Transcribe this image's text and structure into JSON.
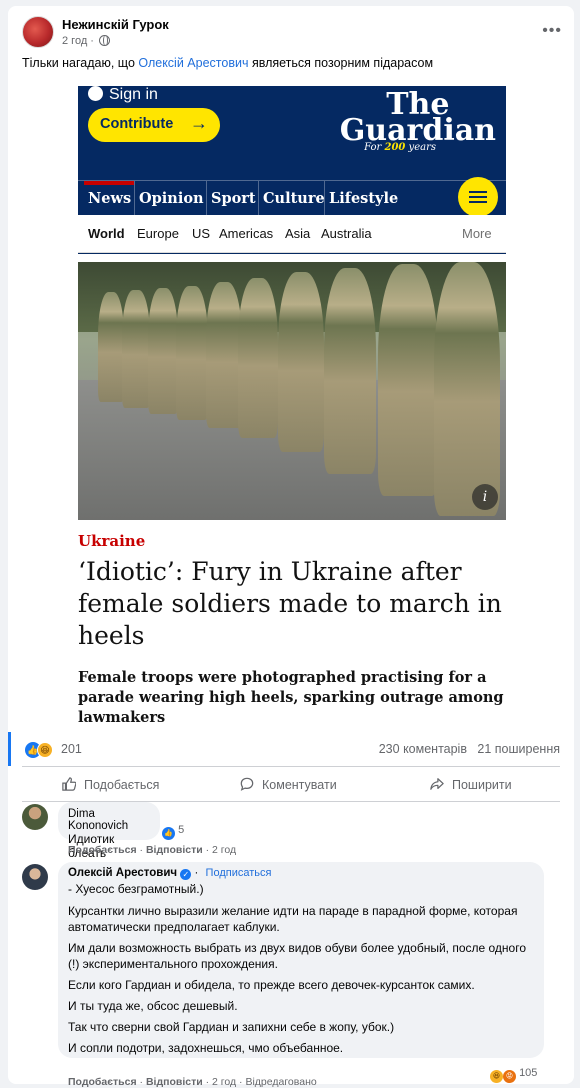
{
  "post": {
    "author": "Нежинскій Гурок",
    "time": "2 год",
    "text_before": "Тільки нагадаю, що ",
    "mention": "Олексій Арестович",
    "text_after": "  являеться позорним підарасом"
  },
  "guardian": {
    "sign_in": "Sign in",
    "contribute": "Contribute",
    "logo_line1": "The",
    "logo_line2": "Guardian",
    "tagline_prefix": "For ",
    "tagline_number": "200",
    "tagline_suffix": " years",
    "pillars": [
      "News",
      "Opinion",
      "Sport",
      "Culture",
      "Lifestyle"
    ],
    "subnav": [
      "World",
      "Europe",
      "US",
      "Americas",
      "Asia",
      "Australia"
    ],
    "subnav_more": "More",
    "kicker": "Ukraine",
    "headline": "‘Idiotic’: Fury in Ukraine after female soldiers made to march in heels",
    "standfirst": "Female troops were photographed practising for a parade wearing high heels, sparking outrage among lawmakers",
    "info_glyph": "i"
  },
  "stats": {
    "reactions": "201",
    "comments": "230 коментарів",
    "shares": "21 поширення"
  },
  "actions": {
    "like": "Подобається",
    "comment": "Коментувати",
    "share": "Поширити"
  },
  "comments": [
    {
      "author": "Dima Kononovich",
      "text": "Идиотик блеать",
      "reaction_count": "5",
      "like": "Подобається",
      "reply": "Відповісти",
      "time": "2 год"
    },
    {
      "author": "Олексій Арестович",
      "follow": "Подписаться",
      "paragraphs": [
        "- Хуесос безграмотный.)",
        "Курсантки лично выразили желание идти на параде в парадной форме, которая автоматически предполагает каблуки.",
        "Им дали возможность выбрать из двух видов обуви более удобный, после одного (!) экспериментального прохождения.",
        "Если кого Гардиан и обидела, то прежде всего девочек-курсанток самих.",
        "И ты туда же, обсос дешевый.",
        "Так что сверни свой Гардиан и запихни себе в жопу, убок.)",
        "И сопли подотри, задохнешься, чмо объебанное."
      ],
      "reaction_count": "105",
      "like": "Подобається",
      "reply": "Відповісти",
      "time": "2 год",
      "edited": "Відредаговано"
    }
  ],
  "icons": {
    "more": "more-horizontal-icon",
    "globe": "globe-icon",
    "like": "thumbs-up-icon",
    "comment": "comment-bubble-icon",
    "share": "share-arrow-icon"
  },
  "colors": {
    "guardian_navy": "#052962",
    "guardian_yellow": "#ffe500",
    "guardian_red": "#c70000",
    "facebook_blue": "#1877f2"
  }
}
